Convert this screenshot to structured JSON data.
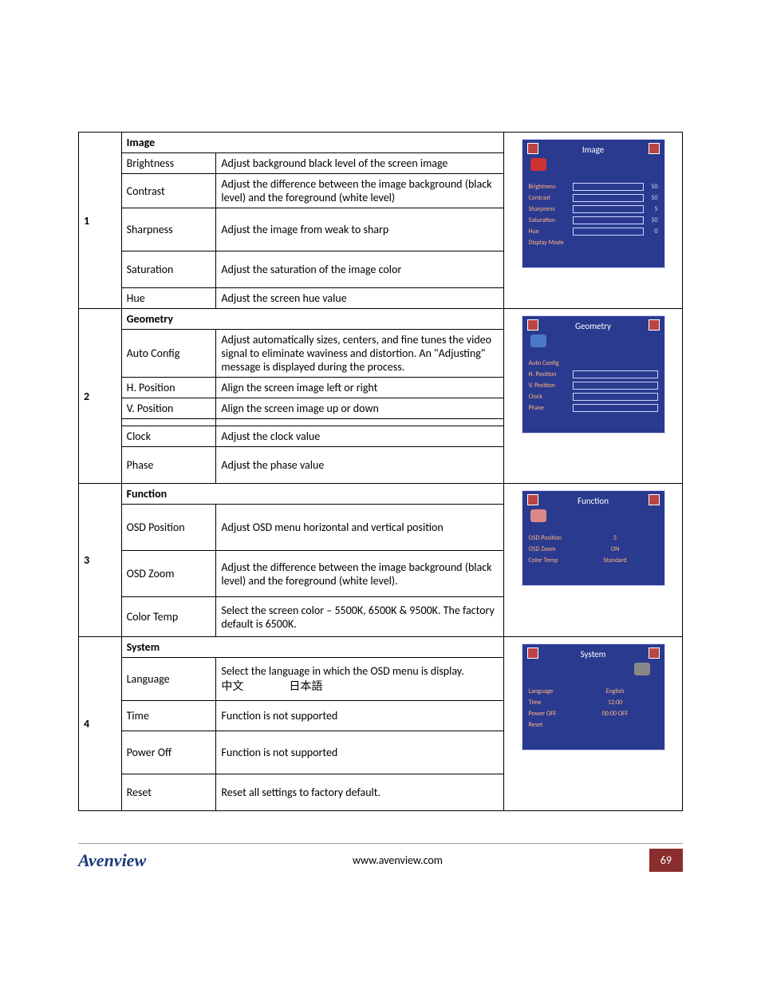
{
  "sections": [
    {
      "num": "1",
      "header": "Image",
      "rows": [
        {
          "label": "Brightness",
          "desc": "Adjust background black level of the screen image"
        },
        {
          "label": "Contrast",
          "desc": "Adjust the difference between the image background (black level) and the foreground (white level)"
        },
        {
          "label": "Sharpness",
          "desc": "Adjust the image from weak to sharp"
        },
        {
          "label": "Saturation",
          "desc": "Adjust the saturation of the image color"
        },
        {
          "label": "Hue",
          "desc": "Adjust the screen hue value"
        }
      ],
      "osd": {
        "title": "Image",
        "items": [
          {
            "k": "Brightness",
            "v": "50"
          },
          {
            "k": "Contrast",
            "v": "50"
          },
          {
            "k": "Sharpness",
            "v": "5"
          },
          {
            "k": "Saturation",
            "v": "50"
          },
          {
            "k": "Hue",
            "v": "0"
          },
          {
            "k": "Display Mode",
            "v": ""
          }
        ]
      }
    },
    {
      "num": "2",
      "header": "Geometry",
      "rows": [
        {
          "label": "Auto Config",
          "desc": "Adjust automatically sizes, centers, and fine tunes the video signal to eliminate waviness and distortion. An \"Adjusting\" message is displayed during the process."
        },
        {
          "label": "H. Position",
          "desc": "Align the screen image left or right"
        },
        {
          "label": "V. Position",
          "desc": "Align the screen image up or down"
        },
        {
          "label": "",
          "desc": ""
        },
        {
          "label": "Clock",
          "desc": "Adjust the clock value"
        },
        {
          "label": "Phase",
          "desc": "Adjust the phase value"
        }
      ],
      "osd": {
        "title": "Geometry",
        "items": [
          {
            "k": "Auto Config",
            "v": ""
          },
          {
            "k": "H. Position",
            "v": ""
          },
          {
            "k": "V. Position",
            "v": ""
          },
          {
            "k": "Clock",
            "v": ""
          },
          {
            "k": "Phase",
            "v": ""
          }
        ]
      }
    },
    {
      "num": "3",
      "header": "Function",
      "rows": [
        {
          "label": "OSD Position",
          "desc": "Adjust OSD menu horizontal and vertical position"
        },
        {
          "label": "OSD Zoom",
          "desc": "Adjust the difference between the image background (black level) and the foreground (white level)."
        },
        {
          "label": "Color Temp",
          "desc": "Select the screen color – 5500K, 6500K & 9500K. The factory default is 6500K."
        }
      ],
      "osd": {
        "title": "Function",
        "items_text": [
          {
            "k": "OSD Position",
            "v": "5"
          },
          {
            "k": "OSD Zoom",
            "v": "ON"
          },
          {
            "k": "Color Temp",
            "v": "Standard"
          }
        ]
      }
    },
    {
      "num": "4",
      "header": "System",
      "rows": [
        {
          "label": "Language",
          "desc": "Select the language in which the OSD menu is display.                          中文                  日本語"
        },
        {
          "label": "Time",
          "desc": "Function is not supported"
        },
        {
          "label": "Power Off",
          "desc": "Function is not supported"
        },
        {
          "label": "Reset",
          "desc": "Reset all settings to factory default."
        }
      ],
      "osd": {
        "title": "System",
        "items_text": [
          {
            "k": "Language",
            "v": "English"
          },
          {
            "k": "Time",
            "v": "12:00"
          },
          {
            "k": "Power OFF",
            "v": "00:00    OFF"
          },
          {
            "k": "Reset",
            "v": ""
          }
        ]
      }
    }
  ],
  "footer": {
    "logo": "Avenview",
    "url": "www.avenview.com",
    "page": "69"
  }
}
